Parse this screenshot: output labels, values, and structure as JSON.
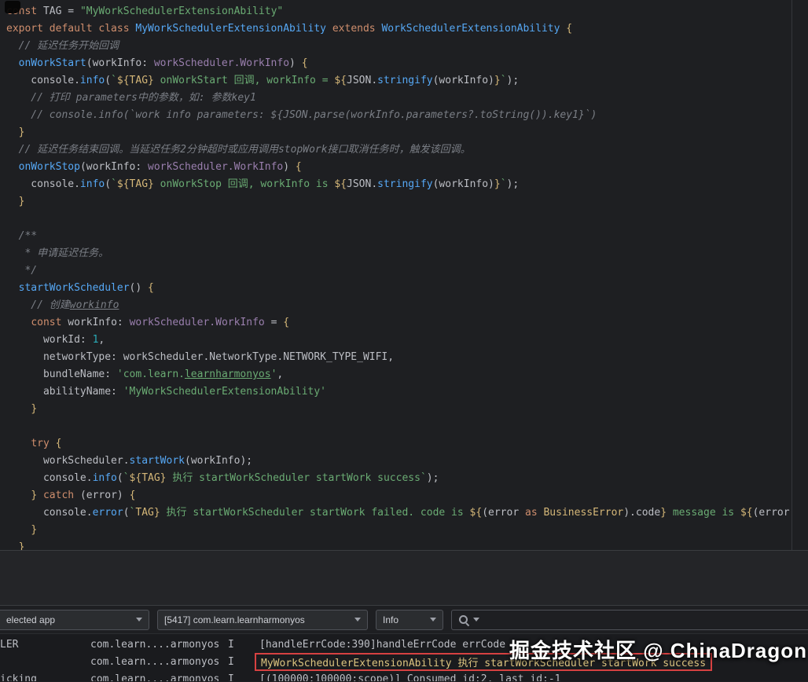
{
  "editor": {
    "lines": [
      [
        [
          "kw",
          "const "
        ],
        [
          "pn",
          "TAG = "
        ],
        [
          "str",
          "\"MyWorkSchedulerExtensionAbility\""
        ]
      ],
      [
        [
          "kw",
          "export default class "
        ],
        [
          "cls",
          "MyWorkSchedulerExtensionAbility"
        ],
        [
          "kw",
          " extends "
        ],
        [
          "cls",
          "WorkSchedulerExtensionAbility"
        ],
        [
          "br",
          " {"
        ]
      ],
      [
        [
          "cmt",
          "  // 延迟任务开始回调"
        ]
      ],
      [
        [
          "pn",
          "  "
        ],
        [
          "fn",
          "onWorkStart"
        ],
        [
          "pn",
          "(workInfo: "
        ],
        [
          "type",
          "workScheduler.WorkInfo"
        ],
        [
          "pn",
          ") "
        ],
        [
          "br",
          "{"
        ]
      ],
      [
        [
          "pn",
          "    console."
        ],
        [
          "fn",
          "info"
        ],
        [
          "pn",
          "("
        ],
        [
          "str",
          "`"
        ],
        [
          "tpl",
          "${TAG}"
        ],
        [
          "str",
          " onWorkStart 回调, workInfo = "
        ],
        [
          "tpl",
          "${"
        ],
        [
          "pn",
          "JSON."
        ],
        [
          "fn",
          "stringify"
        ],
        [
          "pn",
          "(workInfo)"
        ],
        [
          "tpl",
          "}"
        ],
        [
          "str",
          "`"
        ],
        [
          "pn",
          ");"
        ]
      ],
      [
        [
          "cmt",
          "    // 打印 parameters中的参数，如: 参数key1"
        ]
      ],
      [
        [
          "cmt",
          "    // console.info(`work info parameters: ${JSON.parse(workInfo.parameters?.toString()).key1}`)"
        ]
      ],
      [
        [
          "pn",
          "  "
        ],
        [
          "br",
          "}"
        ]
      ],
      [
        [
          "cmt",
          "  // 延迟任务结束回调。当延迟任务2分钟超时或应用调用stopWork接口取消任务时，触发该回调。"
        ]
      ],
      [
        [
          "pn",
          "  "
        ],
        [
          "fn",
          "onWorkStop"
        ],
        [
          "pn",
          "(workInfo: "
        ],
        [
          "type",
          "workScheduler.WorkInfo"
        ],
        [
          "pn",
          ") "
        ],
        [
          "br",
          "{"
        ]
      ],
      [
        [
          "pn",
          "    console."
        ],
        [
          "fn",
          "info"
        ],
        [
          "pn",
          "("
        ],
        [
          "str",
          "`"
        ],
        [
          "tpl",
          "${TAG}"
        ],
        [
          "str",
          " onWorkStop 回调, workInfo is "
        ],
        [
          "tpl",
          "${"
        ],
        [
          "pn",
          "JSON."
        ],
        [
          "fn",
          "stringify"
        ],
        [
          "pn",
          "(workInfo)"
        ],
        [
          "tpl",
          "}"
        ],
        [
          "str",
          "`"
        ],
        [
          "pn",
          ");"
        ]
      ],
      [
        [
          "pn",
          "  "
        ],
        [
          "br",
          "}"
        ]
      ],
      [],
      [
        [
          "cmt",
          "  /**"
        ]
      ],
      [
        [
          "cmt",
          "   * 申请延迟任务。"
        ]
      ],
      [
        [
          "cmt",
          "   */"
        ]
      ],
      [
        [
          "pn",
          "  "
        ],
        [
          "fn",
          "startWorkScheduler"
        ],
        [
          "pn",
          "() "
        ],
        [
          "br",
          "{"
        ]
      ],
      [
        [
          "cmt",
          "    // 创建"
        ],
        [
          "cmtU",
          "workinfo"
        ]
      ],
      [
        [
          "pn",
          "    "
        ],
        [
          "kw",
          "const "
        ],
        [
          "pn",
          "workInfo: "
        ],
        [
          "type",
          "workScheduler.WorkInfo"
        ],
        [
          "pn",
          " = "
        ],
        [
          "br",
          "{"
        ]
      ],
      [
        [
          "pn",
          "      workId: "
        ],
        [
          "num",
          "1"
        ],
        [
          "pn",
          ","
        ]
      ],
      [
        [
          "pn",
          "      networkType: workScheduler.NetworkType.NETWORK_TYPE_WIFI,"
        ]
      ],
      [
        [
          "pn",
          "      bundleName: "
        ],
        [
          "str",
          "'com.learn."
        ],
        [
          "strU",
          "learnharmonyos"
        ],
        [
          "str",
          "'"
        ],
        [
          "pn",
          ","
        ]
      ],
      [
        [
          "pn",
          "      abilityName: "
        ],
        [
          "str",
          "'MyWorkSchedulerExtensionAbility'"
        ]
      ],
      [
        [
          "pn",
          "    "
        ],
        [
          "br",
          "}"
        ]
      ],
      [],
      [
        [
          "pn",
          "    "
        ],
        [
          "kw",
          "try "
        ],
        [
          "br",
          "{"
        ]
      ],
      [
        [
          "pn",
          "      workScheduler."
        ],
        [
          "fn",
          "startWork"
        ],
        [
          "pn",
          "(workInfo);"
        ]
      ],
      [
        [
          "pn",
          "      console."
        ],
        [
          "fn",
          "info"
        ],
        [
          "pn",
          "("
        ],
        [
          "str",
          "`"
        ],
        [
          "tpl",
          "${TAG}"
        ],
        [
          "str",
          " 执行 startWorkScheduler startWork success"
        ],
        [
          "str",
          "`"
        ],
        [
          "pn",
          ");"
        ]
      ],
      [
        [
          "pn",
          "    "
        ],
        [
          "br",
          "} "
        ],
        [
          "kw",
          "catch "
        ],
        [
          "pn",
          "(error) "
        ],
        [
          "br",
          "{"
        ]
      ],
      [
        [
          "pn",
          "      console."
        ],
        [
          "fn",
          "error"
        ],
        [
          "pn",
          "("
        ],
        [
          "str",
          "`"
        ],
        [
          "tpl",
          "TAG}"
        ],
        [
          "str",
          " 执行 startWorkScheduler startWork failed. code is "
        ],
        [
          "tpl",
          "${"
        ],
        [
          "pn",
          "(error "
        ],
        [
          "kw",
          "as "
        ],
        [
          "warn",
          "BusinessError"
        ],
        [
          "pn",
          ").code"
        ],
        [
          "tpl",
          "}"
        ],
        [
          "str",
          " message is "
        ],
        [
          "tpl",
          "${"
        ],
        [
          "pn",
          "(error"
        ]
      ],
      [
        [
          "pn",
          "    "
        ],
        [
          "br",
          "}"
        ]
      ],
      [
        [
          "pn",
          "  "
        ],
        [
          "br",
          "}"
        ]
      ]
    ]
  },
  "logcat": {
    "toolbar": {
      "device_selector": "elected app",
      "process_selector": "[5417] com.learn.learnharmonyos",
      "level_selector": "Info"
    },
    "rows": [
      {
        "tag": "LER",
        "pkg": "com.learn....armonyos",
        "level": "I",
        "msg": "[handleErrCode:390]handleErrCode errCode",
        "highlighted": false
      },
      {
        "tag": "",
        "pkg": "com.learn....armonyos",
        "level": "I",
        "msg": "MyWorkSchedulerExtensionAbility 执行 startWorkScheduler startWork success",
        "highlighted": true
      },
      {
        "tag": "icking",
        "pkg": "com.learn....armonyos",
        "level": "I",
        "msg": "[(100000:100000:scope)] Consumed id:2, last id:-1",
        "highlighted": false
      }
    ]
  },
  "watermark": "掘金技术社区 @ ChinaDragon"
}
